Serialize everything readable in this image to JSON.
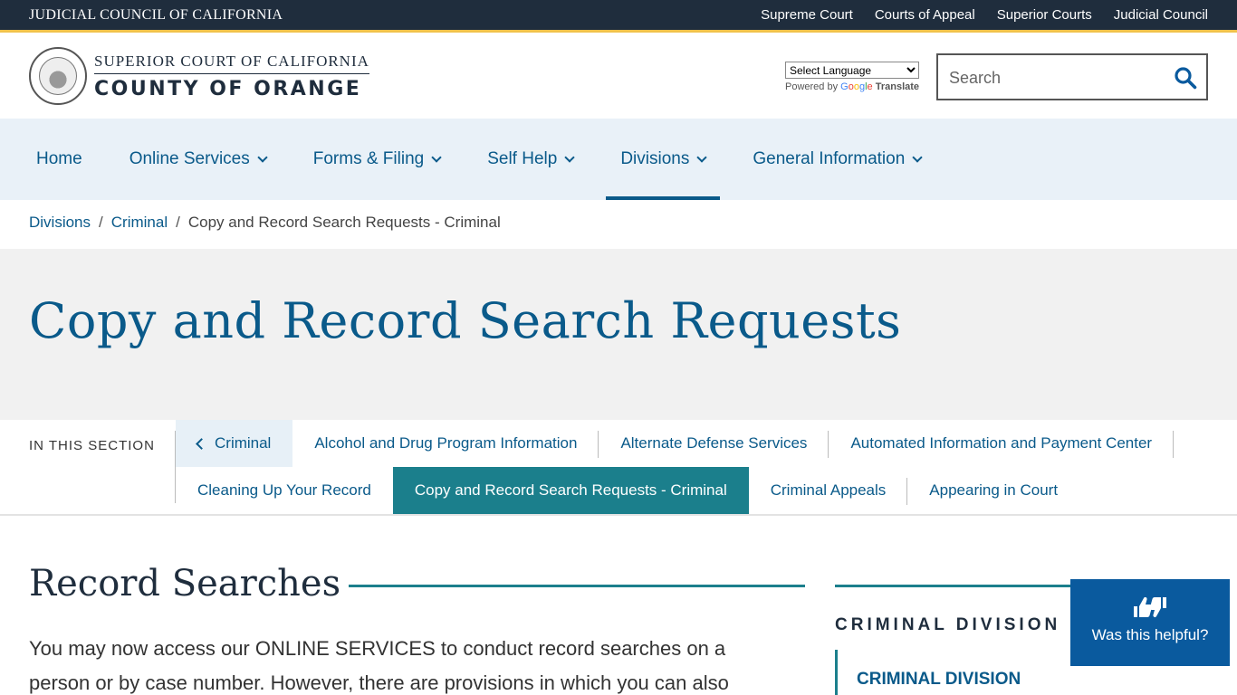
{
  "topbar": {
    "org": "JUDICIAL COUNCIL OF CALIFORNIA",
    "links": [
      "Supreme Court",
      "Courts of Appeal",
      "Superior Courts",
      "Judicial Council"
    ]
  },
  "header": {
    "brand_line1": "SUPERIOR COURT OF CALIFORNIA",
    "brand_line2": "COUNTY OF ORANGE",
    "language_select": "Select Language",
    "powered_by": "Powered by",
    "google": [
      "G",
      "o",
      "o",
      "g",
      "l",
      "e"
    ],
    "translate": "Translate",
    "search_placeholder": "Search"
  },
  "nav": {
    "items": [
      {
        "label": "Home"
      },
      {
        "label": "Online Services"
      },
      {
        "label": "Forms & Filing"
      },
      {
        "label": "Self Help"
      },
      {
        "label": "Divisions"
      },
      {
        "label": "General Information"
      }
    ]
  },
  "breadcrumb": {
    "items": [
      "Divisions",
      "Criminal"
    ],
    "current": "Copy and Record Search Requests - Criminal",
    "separator": "/"
  },
  "hero": {
    "title": "Copy and Record Search Requests"
  },
  "section_nav": {
    "label": "IN THIS SECTION",
    "back": "Criminal",
    "row1": [
      "Alcohol and Drug Program Information",
      "Alternate Defense Services",
      "Automated Information and Payment Center"
    ],
    "row2_before": "Cleaning Up Your Record",
    "current": "Copy and Record Search Requests - Criminal",
    "row2_after": [
      "Criminal Appeals",
      "Appearing in Court"
    ]
  },
  "main": {
    "heading": "Record Searches",
    "paragraph": "You may now access our ONLINE SERVICES to conduct record searches on a person or by case number. However, there are provisions in which you can also"
  },
  "sidebar": {
    "title": "CRIMINAL DIVISION",
    "item": "CRIMINAL DIVISION"
  },
  "feedback": {
    "label": "Was this helpful?"
  },
  "colors": {
    "topbar": "#1f2d3d",
    "accent_gold": "#f0c24b",
    "link_blue": "#0a5a8a",
    "teal": "#1b7f8c",
    "nav_bg": "#e9f1f8",
    "feedback_bg": "#0a5a9e"
  }
}
